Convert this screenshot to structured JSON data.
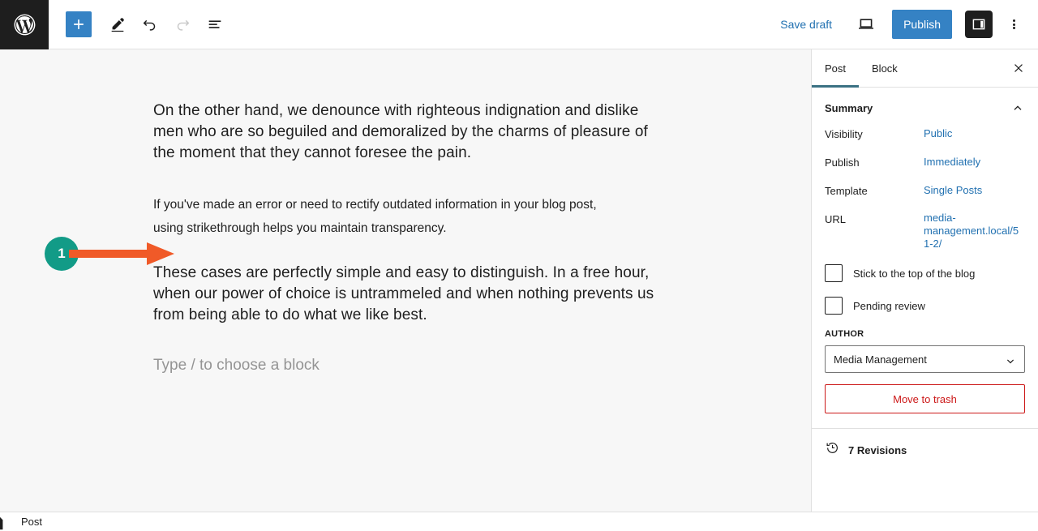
{
  "app": {
    "logo_icon": "wordpress-logo-icon",
    "name": "WordPress Block Editor"
  },
  "toolbar": {
    "add_block_label": "+",
    "add_block_icon": "plus-icon",
    "tools": [
      {
        "name": "edit-tool",
        "icon": "pencil-icon",
        "label": "Tools",
        "disabled": false
      },
      {
        "name": "undo",
        "icon": "undo-icon",
        "label": "Undo",
        "disabled": false
      },
      {
        "name": "redo",
        "icon": "redo-icon",
        "label": "Redo",
        "disabled": true
      },
      {
        "name": "document-overview",
        "icon": "list-view-icon",
        "label": "Document Overview",
        "disabled": false
      }
    ],
    "save_draft_label": "Save draft",
    "preview_icon": "laptop-preview-icon",
    "publish_label": "Publish",
    "sidebar_toggle_icon": "sidebar-panel-icon",
    "options_icon": "kebab-menu-icon",
    "accent_blue": "#3582c4",
    "link_blue": "#2271b1"
  },
  "editor": {
    "paragraphs": [
      {
        "id": "paragraph-1",
        "size": "large",
        "text": "On the other hand, we denounce with righteous indignation and dislike men who are so beguiled and demoralized by the charms of pleasure of the moment that they cannot foresee the pain."
      },
      {
        "id": "paragraph-2",
        "size": "small",
        "text": "If you've made an error or need to rectify outdated information in your blog post, using strikethrough helps you maintain transparency."
      },
      {
        "id": "paragraph-3",
        "size": "large",
        "text": "These cases are perfectly simple and easy to distinguish. In a free hour, when our power of choice is untrammeled and when nothing prevents us from being able to do what we like best."
      }
    ],
    "empty_block_placeholder": "Type / to choose a block",
    "canvas_background": "#f7f7f7"
  },
  "annotation": {
    "number": "1",
    "circle_color": "#129b87",
    "arrow_color": "#f05a28",
    "arrow_icon": "right-arrow-icon"
  },
  "sidebar": {
    "tabs": [
      {
        "label": "Post",
        "active": true
      },
      {
        "label": "Block",
        "active": false
      }
    ],
    "active_tab_underline": "#3a7183",
    "close_icon": "close-icon",
    "summary": {
      "title": "Summary",
      "collapse_icon": "chevron-up-icon",
      "rows": [
        {
          "label": "Visibility",
          "value": "Public"
        },
        {
          "label": "Publish",
          "value": "Immediately"
        },
        {
          "label": "Template",
          "value": "Single Posts"
        },
        {
          "label": "URL",
          "value": "media-management.local/51-2/"
        }
      ]
    },
    "checkboxes": [
      {
        "label": "Stick to the top of the blog",
        "checked": false
      },
      {
        "label": "Pending review",
        "checked": false
      }
    ],
    "author": {
      "label": "AUTHOR",
      "selected": "Media Management",
      "chevron_icon": "chevron-down-icon",
      "options": [
        "Media Management"
      ]
    },
    "trash": {
      "label": "Move to trash",
      "color": "#cc1818"
    },
    "revisions": {
      "label": "7 Revisions",
      "icon": "history-clock-icon"
    }
  },
  "statusbar": {
    "label": "Post",
    "icon": "document-icon"
  }
}
